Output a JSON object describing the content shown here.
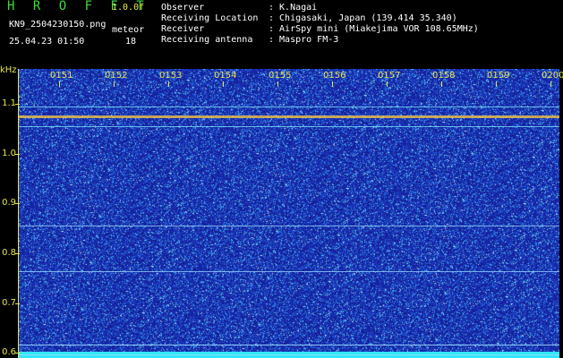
{
  "header": {
    "app_title": "H R O F F T",
    "app_version": "1.0.0f",
    "file_name": "KN9_2504230150.png",
    "unit_label": "meteor",
    "timestamp": "25.04.23 01:50",
    "count_value": "18"
  },
  "metadata": [
    {
      "key": "Observer",
      "value": ": K.Nagai"
    },
    {
      "key": "Receiving Location",
      "value": ": Chigasaki, Japan (139.414 35.340)"
    },
    {
      "key": "Receiver",
      "value": ": AirSpy mini (Miakejima VOR 108.65MHz)"
    },
    {
      "key": "Receiving antenna",
      "value": ": Maspro FM-3"
    }
  ],
  "chart_data": {
    "type": "heatmap",
    "ylabel": "kHz",
    "yticks": [
      "1.1",
      "1.0",
      "0.9",
      "0.8",
      "0.7",
      "0.6"
    ],
    "ylim": [
      0.59,
      1.17
    ],
    "xticks": [
      "0151",
      "0152",
      "0153",
      "0154",
      "0155",
      "0156",
      "0157",
      "0158",
      "0159",
      "0200"
    ],
    "xlim": [
      "0150",
      "0200"
    ],
    "lines_khz": [
      1.095,
      1.077,
      1.055,
      0.855,
      0.765,
      0.617,
      0.597
    ],
    "colors": {
      "background": "#15209a",
      "axis": "#e6e64a",
      "signal": "#ffcc40",
      "bottom_band": "#30e8ff"
    }
  }
}
